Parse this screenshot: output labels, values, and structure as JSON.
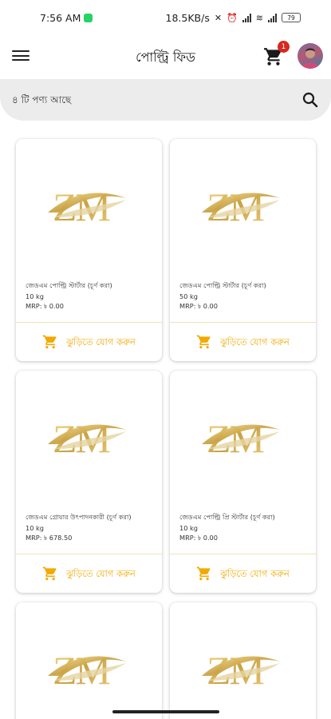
{
  "status_bar": {
    "time": "7:56 AM",
    "network_speed": "18.5KB/s",
    "battery": "79"
  },
  "app_bar": {
    "title": "পোল্ট্রি ফিড",
    "cart_count": "1",
    "menu_icon": "hamburger-menu-icon",
    "cart_icon": "shopping-cart-icon"
  },
  "search": {
    "placeholder": "৪ টি পণ্য আছে",
    "icon": "search-icon"
  },
  "colors": {
    "accent": "#f2a900",
    "badge": "#d7281f",
    "search_bg": "#ececec"
  },
  "products": [
    {
      "name": "জেডএম পোল্ট্রি স্টার্টার (চূর্ণ করা)",
      "weight": "10 kg",
      "mrp": "MRP: ৳ 0.00",
      "cta": "ঝুড়িতে যোগ করুন",
      "logo": "ZM"
    },
    {
      "name": "জেডএম পোল্ট্রি স্টার্টার (চূর্ণ করা)",
      "weight": "50 kg",
      "mrp": "MRP: ৳ 0.00",
      "cta": "ঝুড়িতে যোগ করুন",
      "logo": "ZM"
    },
    {
      "name": "জেডএম গ্রোয়ার উৎপাদনকারী (চূর্ণ করা)",
      "weight": "10 kg",
      "mrp": "MRP: ৳ 678.50",
      "cta": "ঝুড়িতে যোগ করুন",
      "logo": "ZM"
    },
    {
      "name": "জেডএম পোল্ট্রি প্রি স্টার্টার (চূর্ণ করা)",
      "weight": "10 kg",
      "mrp": "MRP: ৳ 0.00",
      "cta": "ঝুড়িতে যোগ করুন",
      "logo": "ZM"
    },
    {
      "logo": "ZM"
    },
    {
      "logo": "ZM"
    }
  ]
}
